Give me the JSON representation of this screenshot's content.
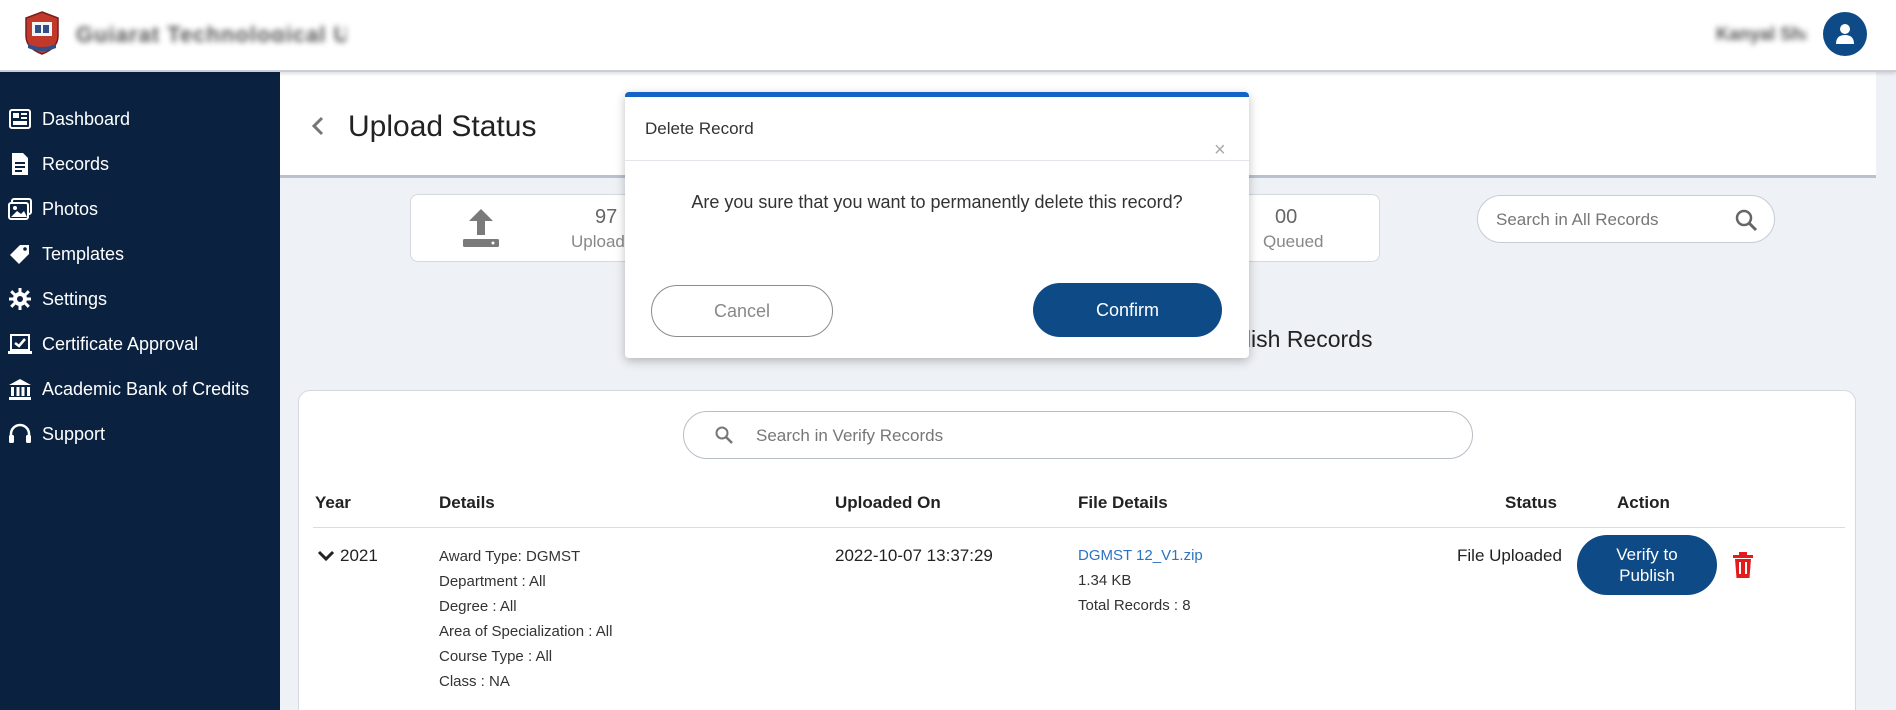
{
  "header": {
    "brand_text": "Gujarat Technological University",
    "user_name": "Kanyal Shah",
    "logo_icon": "university-crest-icon",
    "avatar_icon": "user-icon"
  },
  "sidebar": {
    "items": [
      {
        "label": "Dashboard",
        "icon": "dashboard-icon"
      },
      {
        "label": "Records",
        "icon": "document-icon"
      },
      {
        "label": "Photos",
        "icon": "photos-icon"
      },
      {
        "label": "Templates",
        "icon": "tag-icon"
      },
      {
        "label": "Settings",
        "icon": "gear-icon"
      },
      {
        "label": "Certificate Approval",
        "icon": "approval-icon"
      },
      {
        "label": "Academic Bank of Credits",
        "icon": "bank-icon"
      },
      {
        "label": "Support",
        "icon": "headset-icon"
      }
    ]
  },
  "main": {
    "title": "Upload Status",
    "stats": {
      "uploaded_count": "97",
      "uploaded_label": "Uploaded",
      "queued_count": "00",
      "queued_label": "Queued"
    },
    "search_all_placeholder": "Search in All Records",
    "publish_tab_label": "Publish Records",
    "search_verify_placeholder": "Search in Verify Records",
    "table": {
      "columns": [
        "Year",
        "Details",
        "Uploaded On",
        "File Details",
        "Status",
        "Action"
      ],
      "rows": [
        {
          "year": "2021",
          "details": [
            "Award Type: DGMST",
            "Department : All",
            "Degree : All",
            "Area of Specialization : All",
            "Course Type : All",
            "Class : NA"
          ],
          "uploaded_on": "2022-10-07 13:37:29",
          "file_name": "DGMST 12_V1.zip",
          "file_size": "1.34 KB",
          "total_records": "Total Records : 8",
          "status": "File Uploaded",
          "action_label": "Verify to Publish"
        }
      ]
    }
  },
  "modal": {
    "title": "Delete Record",
    "close_glyph": "×",
    "message": "Are you sure that you want to permanently delete this record?",
    "cancel_label": "Cancel",
    "confirm_label": "Confirm"
  },
  "colors": {
    "sidebar_bg": "#0a2240",
    "primary": "#0d4a86",
    "modal_accent": "#1264c8",
    "link": "#2d73c2",
    "danger": "#e31b1b"
  }
}
